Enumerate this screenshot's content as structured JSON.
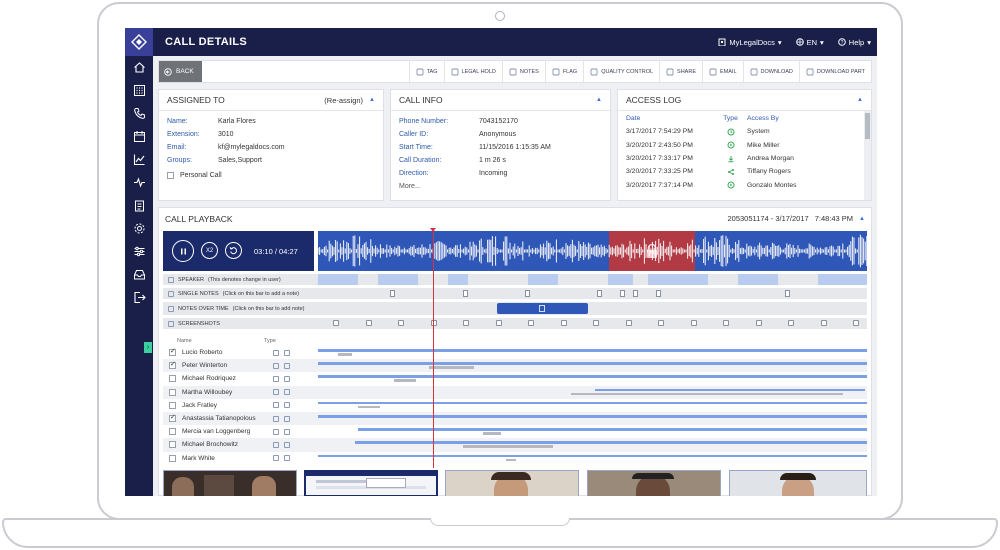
{
  "app": {
    "title": "CALL DETAILS",
    "account": "MyLegalDocs",
    "language": "EN",
    "help": "Help"
  },
  "sidebar": {
    "icons": [
      "home-icon",
      "dialpad-icon",
      "phone-icon",
      "calendar-icon",
      "chart-icon",
      "activity-icon",
      "clipboard-icon",
      "gear-icon",
      "sliders-icon",
      "inbox-icon",
      "logout-icon"
    ]
  },
  "toolbar": {
    "back": "BACK",
    "actions": [
      {
        "label": "TAG",
        "icon": "tag-icon"
      },
      {
        "label": "LEGAL HOLD",
        "icon": "legal-hold-icon"
      },
      {
        "label": "NOTES",
        "icon": "notes-icon"
      },
      {
        "label": "FLAG",
        "icon": "flag-icon"
      },
      {
        "label": "QUALITY CONTROL",
        "icon": "quality-control-icon"
      },
      {
        "label": "SHARE",
        "icon": "share-icon"
      },
      {
        "label": "EMAIL",
        "icon": "email-icon"
      },
      {
        "label": "DOWNLOAD",
        "icon": "download-icon"
      },
      {
        "label": "DOWNLOAD PART",
        "icon": "download-part-icon"
      }
    ]
  },
  "assigned": {
    "title": "ASSIGNED TO",
    "reassign": "(Re-assign)",
    "fields": [
      {
        "k": "Name:",
        "v": "Karla Flores"
      },
      {
        "k": "Extension:",
        "v": "3010"
      },
      {
        "k": "Email:",
        "v": "kf@mylegaldocs.com"
      },
      {
        "k": "Groups:",
        "v": "Sales,Support"
      }
    ],
    "personal_call": "Personal Call"
  },
  "call_info": {
    "title": "CALL INFO",
    "fields": [
      {
        "k": "Phone Number:",
        "v": "7043152170"
      },
      {
        "k": "Caller ID:",
        "v": "Anonymous"
      },
      {
        "k": "Start Time:",
        "v": "11/15/2016 1:15:35 AM"
      },
      {
        "k": "Call Duration:",
        "v": "1 m 26 s"
      },
      {
        "k": "Direction:",
        "v": "Incoming"
      }
    ],
    "more": "More..."
  },
  "access_log": {
    "title": "ACCESS LOG",
    "headers": [
      "Date",
      "Type",
      "Access By"
    ],
    "rows": [
      {
        "date": "3/17/2017 7:54:29 PM",
        "type": "system",
        "by": "System"
      },
      {
        "date": "3/20/2017 2:43:50 PM",
        "type": "play",
        "by": "Mike Miller"
      },
      {
        "date": "3/20/2017 7:33:17 PM",
        "type": "download",
        "by": "Andrea Morgan"
      },
      {
        "date": "3/20/2017 7:33:25 PM",
        "type": "share",
        "by": "Tiffany Rogers"
      },
      {
        "date": "3/20/2017 7:37:14 PM",
        "type": "play",
        "by": "Gonzalo Montes"
      }
    ]
  },
  "playback": {
    "title": "CALL PLAYBACK",
    "range": "2053051174 - 3/17/2017",
    "time": "7:48:43 PM",
    "speed": "X2",
    "current": "03:10",
    "total": "04:27",
    "progress": 0.71,
    "tracks": {
      "speaker": "SPEAKER",
      "speaker_hint": "(This denotes change in user)",
      "single_notes": "SINGLE NOTES",
      "single_notes_hint": "(Click on this bar to add a note)",
      "notes_over_time": "NOTES OVER TIME",
      "notes_over_time_hint": "(Click on this bar to add note)",
      "screenshots": "SCREENSHOTS"
    },
    "participants_headers": [
      "Name",
      "Type"
    ],
    "participants": [
      {
        "name": "Lucio Roberto",
        "checked": true
      },
      {
        "name": "Peter Winterton",
        "checked": true
      },
      {
        "name": "Michael Rodriquez",
        "checked": false
      },
      {
        "name": "Martha Willoubey",
        "checked": false
      },
      {
        "name": "Jack Fratley",
        "checked": false
      },
      {
        "name": "Anastassia Tatianopolous",
        "checked": true
      },
      {
        "name": "Mercia van Loggenberg",
        "checked": false
      },
      {
        "name": "Michael Brochowitz",
        "checked": false
      },
      {
        "name": "Mark White",
        "checked": false
      }
    ]
  },
  "colors": {
    "navy": "#1a1f4a",
    "accent_blue": "#2f57b8",
    "link_blue": "#2e5aac",
    "lock_red": "#b23a44",
    "playhead": "#d6333c"
  }
}
